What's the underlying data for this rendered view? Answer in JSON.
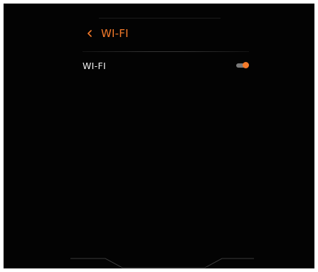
{
  "header": {
    "title": "WI-FI",
    "back_icon": "chevron-left-icon"
  },
  "settings": {
    "wifi_label": "WI-FI",
    "wifi_enabled": true
  },
  "colors": {
    "accent": "#f47a2a",
    "background": "#030303",
    "text": "#f2f2f2",
    "toggle_track": "#7a7a7a"
  }
}
